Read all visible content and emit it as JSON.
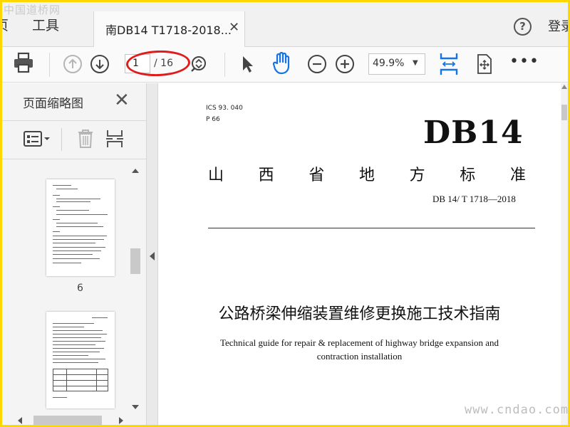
{
  "watermarks": {
    "top": "中国道桥网",
    "bottom": "www.cndao.com"
  },
  "tabbar": {
    "home_label": "页",
    "tools_label": "工具",
    "doc_tab_title": "南DB14 T1718-2018...",
    "close_glyph": "✕",
    "help_glyph": "?",
    "login_label": "登录"
  },
  "toolbar": {
    "page_current": "1",
    "page_total": "/ 16",
    "zoom_value": "49.9%",
    "zoom_caret": "▼",
    "more_glyph": "•••",
    "icons": [
      "print-icon",
      "prev-page-icon",
      "next-page-icon",
      "page-nav-icon",
      "select-tool-icon",
      "hand-tool-icon",
      "zoom-out-icon",
      "zoom-in-icon",
      "fit-width-icon",
      "fit-page-icon",
      "more-icon"
    ],
    "accent": "#1473e6",
    "highlight": "#e01b1b"
  },
  "sidebar": {
    "title": "页面缩略图",
    "close_glyph": "✕",
    "tool_icons": [
      "thumbnail-options-icon",
      "delete-page-icon",
      "insert-page-icon"
    ],
    "thumbnails": [
      {
        "label": "6"
      },
      {
        "label": ""
      }
    ]
  },
  "document": {
    "ics": "ICS  93. 040",
    "pcode": "P  66",
    "code": "DB14",
    "standard_type": [
      "山",
      "西",
      "省",
      "地",
      "方",
      "标",
      "准"
    ],
    "standard_number": "DB 14/  T  1718—2018",
    "title_cn": "公路桥梁伸缩装置维修更换施工技术指南",
    "title_en_line1": "Technical guide for repair & replacement of highway bridge expansion and",
    "title_en_line2": "contraction installation"
  }
}
